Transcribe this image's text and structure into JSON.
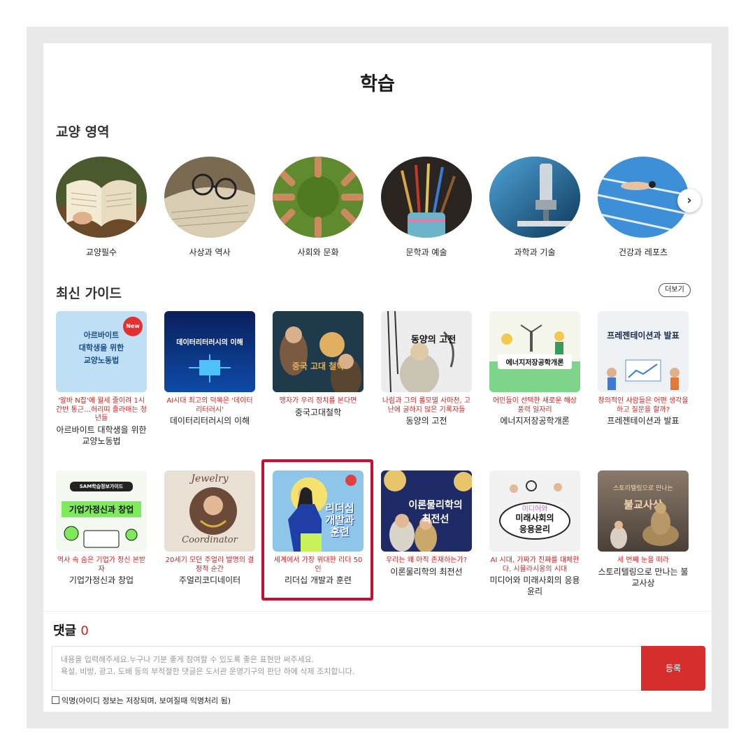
{
  "page": {
    "title": "학습"
  },
  "liberal_arts": {
    "title": "교양 영역",
    "categories": [
      {
        "label": "교양필수"
      },
      {
        "label": "사상과 역사"
      },
      {
        "label": "사회와 문화"
      },
      {
        "label": "문학과 예술"
      },
      {
        "label": "과학과 기술"
      },
      {
        "label": "건강과 레포츠"
      }
    ],
    "next_icon": "›"
  },
  "guides": {
    "title": "최신 가이드",
    "more_label": "더보기",
    "new_badge": "New",
    "items": [
      {
        "thumb_text": "아르바이트\n대학생을 위한\n교양노동법",
        "desc": "'알바 N잡'에 월세 줄이려 1시간반 통근…허리띠 졸라매는 청년들",
        "name": "아르바이트 대학생을 위한 교양노동법"
      },
      {
        "thumb_text": "데이터리터러시의 이해",
        "desc": "AI시대 최고의 덕목은 '데이터 리터러시'",
        "name": "데이터리터러시의 이해"
      },
      {
        "thumb_text": "중국 고대 철학",
        "desc": "맹자가 우리 정치를 본다면",
        "name": "중국고대철학"
      },
      {
        "thumb_text": "동양의 고전",
        "desc": "나림과 그의 롤모델 사마천, 고난에 굴하지 않은 기록자들",
        "name": "동양의 고전"
      },
      {
        "thumb_text": "에너지저장공학개론",
        "desc": "어민들이 선택한 새로운 해상 풍력 일자리",
        "name": "에너지저장공학개론"
      },
      {
        "thumb_text": "프레젠테이션과 발표",
        "desc": "창의적인 사람들은 어떤 생각을 하고 질문을 할까?",
        "name": "프레젠테이션과 발표"
      },
      {
        "thumb_top": "SAM학습정보가이드",
        "thumb_text": "기업가정신과 창업",
        "desc": "역사 속 숨은 기업가 정신 본받자",
        "name": "기업가정신과 창업"
      },
      {
        "thumb_top": "Jewelry",
        "thumb_text": "Coordinator",
        "desc": "20세기 모던 주얼리 발명의 결정적 순간",
        "name": "주얼리코디네이터"
      },
      {
        "thumb_text": "리더십\n개발과\n훈련",
        "desc": "세계에서 가장 위대한 리더 50인",
        "name": "리더십 개발과 훈련"
      },
      {
        "thumb_text": "이론물리학의\n최전선",
        "desc": "우리는 왜 아직 존재하는가?",
        "name": "이론물리학의 최전선"
      },
      {
        "thumb_top": "미디어와",
        "thumb_text": "미래사회의\n응용윤리",
        "desc": "AI 시대, 가짜가 진짜를 대체한다. 시뮬라시옹의 시대",
        "name": "미디어와 미래사회의 응용윤리"
      },
      {
        "thumb_top": "스토리텔링으로 만나는",
        "thumb_text": "불교사상",
        "desc": "세 번째 눈을 떠라",
        "name": "스토리텔링으로 만나는 불교사상"
      }
    ]
  },
  "comments": {
    "title": "댓글",
    "count": "0",
    "placeholder_line1": "내용을 입력해주세요.누구나 기분 좋게 참여할 수 있도록 좋은 표현만 써주세요.",
    "placeholder_line2": "욕설, 비방, 광고, 도배 등의 부적절한 댓글은 도서관 운영기구의 판단 하에 삭제 조치합니다.",
    "submit_label": "등록",
    "anonymous_label": "익명(아이디 정보는 저장되며, 보여질때 익명처리 됨)"
  },
  "colors": {
    "accent": "#d62d2d",
    "highlight_border": "#c8102e"
  }
}
